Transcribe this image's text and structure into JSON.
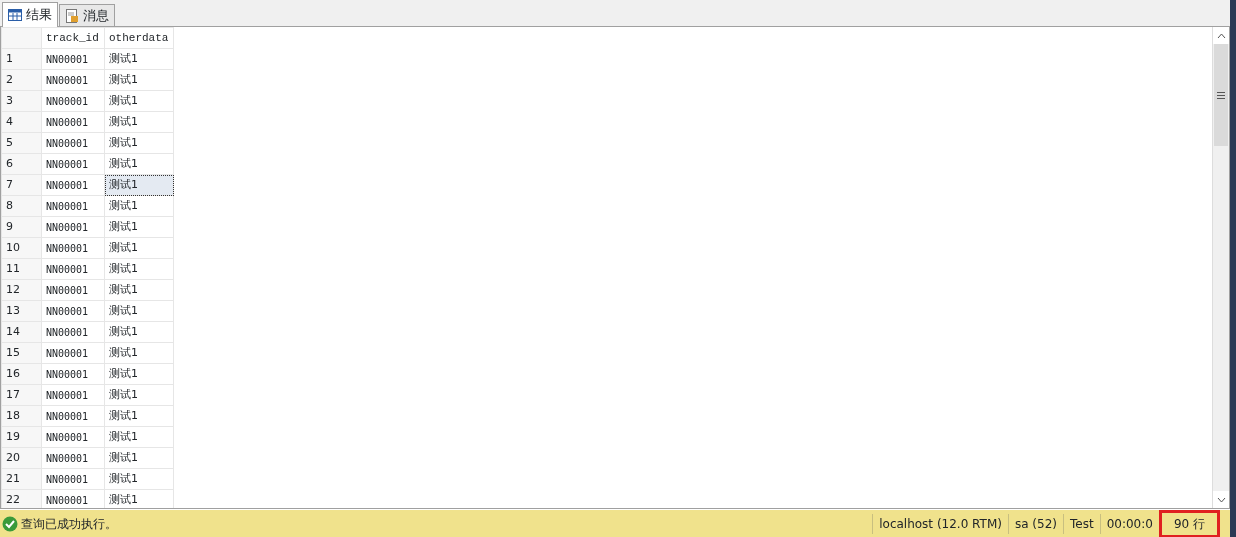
{
  "tabs": [
    {
      "label": "结果",
      "kind": "grid",
      "selected": true
    },
    {
      "label": "消息",
      "kind": "messages",
      "selected": false
    }
  ],
  "table": {
    "columns": [
      "track_id",
      "otherdata"
    ],
    "rows": [
      {
        "number": "1",
        "cells": [
          "NN00001",
          "测试1"
        ],
        "selected": false
      },
      {
        "number": "2",
        "cells": [
          "NN00001",
          "测试1"
        ],
        "selected": false
      },
      {
        "number": "3",
        "cells": [
          "NN00001",
          "测试1"
        ],
        "selected": false
      },
      {
        "number": "4",
        "cells": [
          "NN00001",
          "测试1"
        ],
        "selected": false
      },
      {
        "number": "5",
        "cells": [
          "NN00001",
          "测试1"
        ],
        "selected": false
      },
      {
        "number": "6",
        "cells": [
          "NN00001",
          "测试1"
        ],
        "selected": false
      },
      {
        "number": "7",
        "cells": [
          "NN00001",
          "测试1"
        ],
        "selected": true
      },
      {
        "number": "8",
        "cells": [
          "NN00001",
          "测试1"
        ],
        "selected": false
      },
      {
        "number": "9",
        "cells": [
          "NN00001",
          "测试1"
        ],
        "selected": false
      },
      {
        "number": "10",
        "cells": [
          "NN00001",
          "测试1"
        ],
        "selected": false
      },
      {
        "number": "11",
        "cells": [
          "NN00001",
          "测试1"
        ],
        "selected": false
      },
      {
        "number": "12",
        "cells": [
          "NN00001",
          "测试1"
        ],
        "selected": false
      },
      {
        "number": "13",
        "cells": [
          "NN00001",
          "测试1"
        ],
        "selected": false
      },
      {
        "number": "14",
        "cells": [
          "NN00001",
          "测试1"
        ],
        "selected": false
      },
      {
        "number": "15",
        "cells": [
          "NN00001",
          "测试1"
        ],
        "selected": false
      },
      {
        "number": "16",
        "cells": [
          "NN00001",
          "测试1"
        ],
        "selected": false
      },
      {
        "number": "17",
        "cells": [
          "NN00001",
          "测试1"
        ],
        "selected": false
      },
      {
        "number": "18",
        "cells": [
          "NN00001",
          "测试1"
        ],
        "selected": false
      },
      {
        "number": "19",
        "cells": [
          "NN00001",
          "测试1"
        ],
        "selected": false
      },
      {
        "number": "20",
        "cells": [
          "NN00001",
          "测试1"
        ],
        "selected": false
      },
      {
        "number": "21",
        "cells": [
          "NN00001",
          "测试1"
        ],
        "selected": false
      },
      {
        "number": "22",
        "cells": [
          "NN00001",
          "测试1"
        ],
        "selected": false
      }
    ]
  },
  "status_bar": {
    "message": "查询已成功执行。",
    "items": [
      {
        "text": "localhost (12.0 RTM)",
        "highlighted": false
      },
      {
        "text": "sa (52)",
        "highlighted": false
      },
      {
        "text": "Test",
        "highlighted": false
      },
      {
        "text": "00:00:0",
        "highlighted": false
      },
      {
        "text": "90 行",
        "highlighted": true
      }
    ]
  }
}
